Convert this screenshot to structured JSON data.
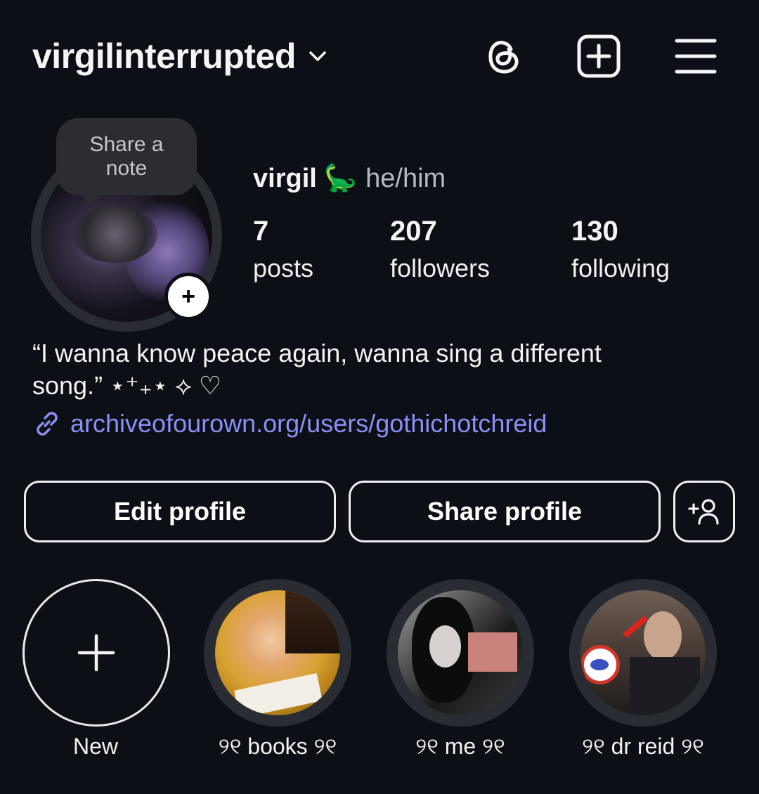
{
  "header": {
    "username": "virgilinterrupted",
    "icons": [
      "threads-icon",
      "create-post-icon",
      "menu-icon"
    ]
  },
  "note": {
    "label": "Share a\nnote"
  },
  "profile": {
    "display_name": "virgil",
    "emoji": "🦕",
    "pronouns": "he/him",
    "stats": [
      {
        "value": "7",
        "label": "posts"
      },
      {
        "value": "207",
        "label": "followers"
      },
      {
        "value": "130",
        "label": "following"
      }
    ],
    "bio_line1": "“I wanna know peace again, wanna sing a different",
    "bio_line2": "song.” ⋆⁺₊⋆ ⟡ ♡",
    "link": "archiveofourown.org/users/gothichotchreid"
  },
  "buttons": {
    "edit": "Edit profile",
    "share": "Share profile"
  },
  "highlights": [
    {
      "label": "New"
    },
    {
      "label": "୨୧ books ୨୧"
    },
    {
      "label": "୨୧ me ୨୧"
    },
    {
      "label": "୨୧ dr reid ୨୧"
    }
  ],
  "colors": {
    "background": "#0d0f17",
    "link": "#8b8ff5",
    "button_border": "#f0f0f0"
  }
}
